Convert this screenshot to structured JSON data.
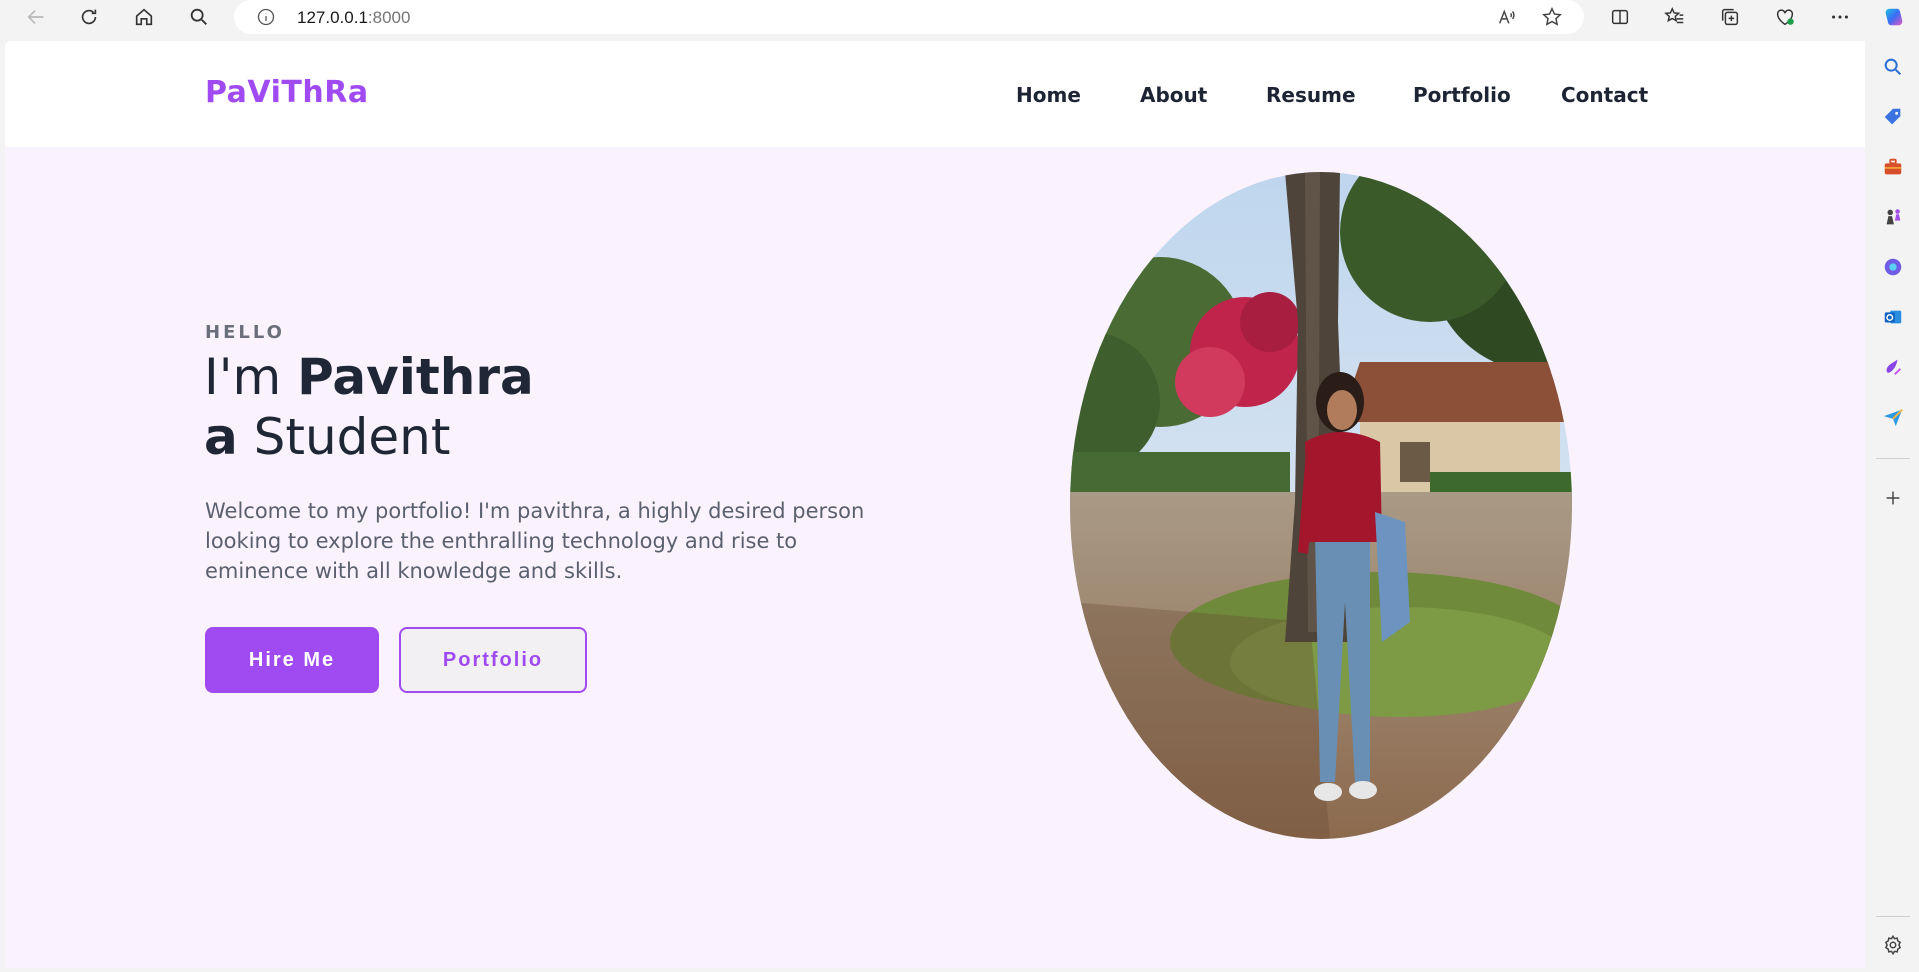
{
  "browser": {
    "url_host": "127.0.0.1",
    "url_port": ":8000",
    "icons": [
      "back-icon",
      "refresh-icon",
      "home-icon",
      "search-icon",
      "site-info-icon",
      "read-aloud-icon",
      "favorite-star-icon",
      "split-screen-icon",
      "favorites-icon",
      "collections-icon",
      "browser-essentials-icon",
      "more-icon",
      "copilot-icon"
    ]
  },
  "sidebar": {
    "icons": [
      "search-icon",
      "shopping-tag-icon",
      "tools-icon",
      "chess-icon",
      "copilot-apps-icon",
      "outlook-icon",
      "drop-icon",
      "send-icon",
      "add-icon",
      "settings-icon"
    ]
  },
  "site": {
    "logo": "PaViThRa",
    "nav": [
      "Home",
      "About",
      "Resume",
      "Portfolio",
      "Contact"
    ],
    "hero": {
      "greeting": "HELLO",
      "line1_light": "I'm ",
      "line1_bold": "Pavithra",
      "line2_bold": "a",
      "line2_light": " Student",
      "description": "Welcome to my portfolio! I'm pavithra, a highly desired person looking to explore the enthralling technology and rise to eminence with all knowledge and skills.",
      "primary_button": "Hire Me",
      "secondary_button": "Portfolio"
    }
  },
  "colors": {
    "accent": "#a04bf2",
    "page_bg": "#faf3fd",
    "heading": "#1f2635",
    "body_text": "#5b6070"
  }
}
